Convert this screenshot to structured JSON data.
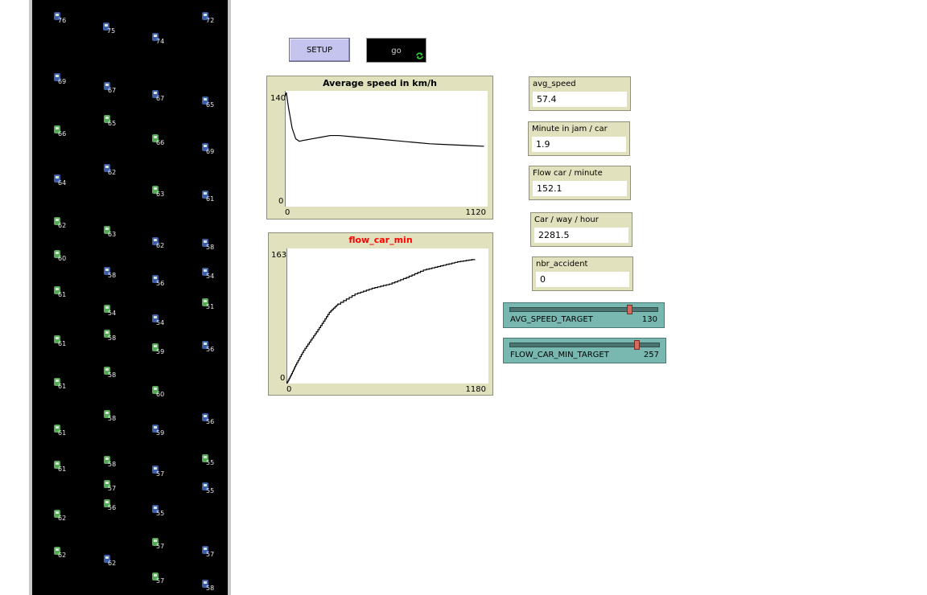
{
  "buttons": {
    "setup_label": "SETUP",
    "go_label": "go"
  },
  "plots": [
    {
      "title": "Average speed in km/h",
      "title_color": "#000000",
      "ymax_label": "140",
      "ymin_label": "0",
      "xmin_label": "0",
      "xmax_label": "1120"
    },
    {
      "title": "flow_car_min",
      "title_color": "#ff0000",
      "ymax_label": "163",
      "ymin_label": "0",
      "xmin_label": "0",
      "xmax_label": "1180"
    }
  ],
  "monitors": [
    {
      "label": "avg_speed",
      "value": "57.4"
    },
    {
      "label": "Minute in jam / car",
      "value": "1.9"
    },
    {
      "label": "Flow car / minute",
      "value": "152.1"
    },
    {
      "label": "Car / way / hour",
      "value": "2281.5"
    },
    {
      "label": "nbr_accident",
      "value": "0"
    }
  ],
  "sliders": [
    {
      "label": "AVG_SPEED_TARGET",
      "value": "130",
      "fraction": 0.82
    },
    {
      "label": "FLOW_CAR_MIN_TARGET",
      "value": "257",
      "fraction": 0.86
    }
  ],
  "colors": {
    "world_bg": "#000000",
    "car_green": "#57a857",
    "car_blue": "#3e5fa8",
    "plot_bg": "#e1e1be",
    "slider_bg": "#78b8b0",
    "setup_bg": "#c4c4ee"
  },
  "cars": [
    {
      "label": "76",
      "color": "blue"
    },
    {
      "label": "75",
      "color": "blue"
    },
    {
      "label": "74",
      "color": "blue"
    },
    {
      "label": "72",
      "color": "blue"
    },
    {
      "label": "69",
      "color": "blue"
    },
    {
      "label": "67",
      "color": "blue"
    },
    {
      "label": "67",
      "color": "blue"
    },
    {
      "label": "65",
      "color": "blue"
    },
    {
      "label": "66",
      "color": "green"
    },
    {
      "label": "65",
      "color": "green"
    },
    {
      "label": "66",
      "color": "green"
    },
    {
      "label": "69",
      "color": "blue"
    },
    {
      "label": "64",
      "color": "blue"
    },
    {
      "label": "62",
      "color": "blue"
    },
    {
      "label": "63",
      "color": "green"
    },
    {
      "label": "61",
      "color": "blue"
    },
    {
      "label": "62",
      "color": "green"
    },
    {
      "label": "63",
      "color": "green"
    },
    {
      "label": "62",
      "color": "blue"
    },
    {
      "label": "58",
      "color": "blue"
    },
    {
      "label": "60",
      "color": "green"
    },
    {
      "label": "58",
      "color": "blue"
    },
    {
      "label": "56",
      "color": "blue"
    },
    {
      "label": "54",
      "color": "blue"
    },
    {
      "label": "61",
      "color": "green"
    },
    {
      "label": "54",
      "color": "green"
    },
    {
      "label": "54",
      "color": "blue"
    },
    {
      "label": "51",
      "color": "green"
    },
    {
      "label": "61",
      "color": "green"
    },
    {
      "label": "58",
      "color": "green"
    },
    {
      "label": "59",
      "color": "green"
    },
    {
      "label": "56",
      "color": "blue"
    },
    {
      "label": "61",
      "color": "green"
    },
    {
      "label": "58",
      "color": "green"
    },
    {
      "label": "60",
      "color": "green"
    },
    {
      "label": "61",
      "color": "green"
    },
    {
      "label": "58",
      "color": "green"
    },
    {
      "label": "59",
      "color": "blue"
    },
    {
      "label": "56",
      "color": "blue"
    },
    {
      "label": "61",
      "color": "green"
    },
    {
      "label": "58",
      "color": "green"
    },
    {
      "label": "57",
      "color": "blue"
    },
    {
      "label": "55",
      "color": "green"
    },
    {
      "label": "57",
      "color": "green"
    },
    {
      "label": "55",
      "color": "blue"
    },
    {
      "label": "62",
      "color": "green"
    },
    {
      "label": "56",
      "color": "green"
    },
    {
      "label": "55",
      "color": "blue"
    },
    {
      "label": "62",
      "color": "green"
    },
    {
      "label": "62",
      "color": "blue"
    },
    {
      "label": "57",
      "color": "green"
    },
    {
      "label": "57",
      "color": "blue"
    },
    {
      "label": "57",
      "color": "green"
    },
    {
      "label": "58",
      "color": "blue"
    }
  ],
  "chart_data": [
    {
      "type": "line",
      "title": "Average speed in km/h",
      "xlim": [
        0,
        1120
      ],
      "ylim": [
        0,
        140
      ],
      "x": [
        0,
        8,
        20,
        40,
        60,
        80,
        100,
        150,
        200,
        250,
        300,
        400,
        500,
        600,
        700,
        800,
        900,
        1000,
        1100
      ],
      "values": [
        133,
        138,
        120,
        95,
        82,
        79,
        80,
        82,
        84,
        86,
        86,
        84,
        82,
        80,
        78,
        76,
        75,
        74,
        73
      ]
    },
    {
      "type": "line",
      "title": "flow_car_min",
      "xlim": [
        0,
        1180
      ],
      "ylim": [
        0,
        163
      ],
      "x": [
        0,
        30,
        60,
        100,
        150,
        200,
        250,
        300,
        400,
        500,
        600,
        700,
        800,
        900,
        1000,
        1100
      ],
      "values": [
        0,
        12,
        25,
        40,
        55,
        70,
        86,
        96,
        108,
        115,
        120,
        128,
        137,
        142,
        147,
        150
      ]
    }
  ]
}
